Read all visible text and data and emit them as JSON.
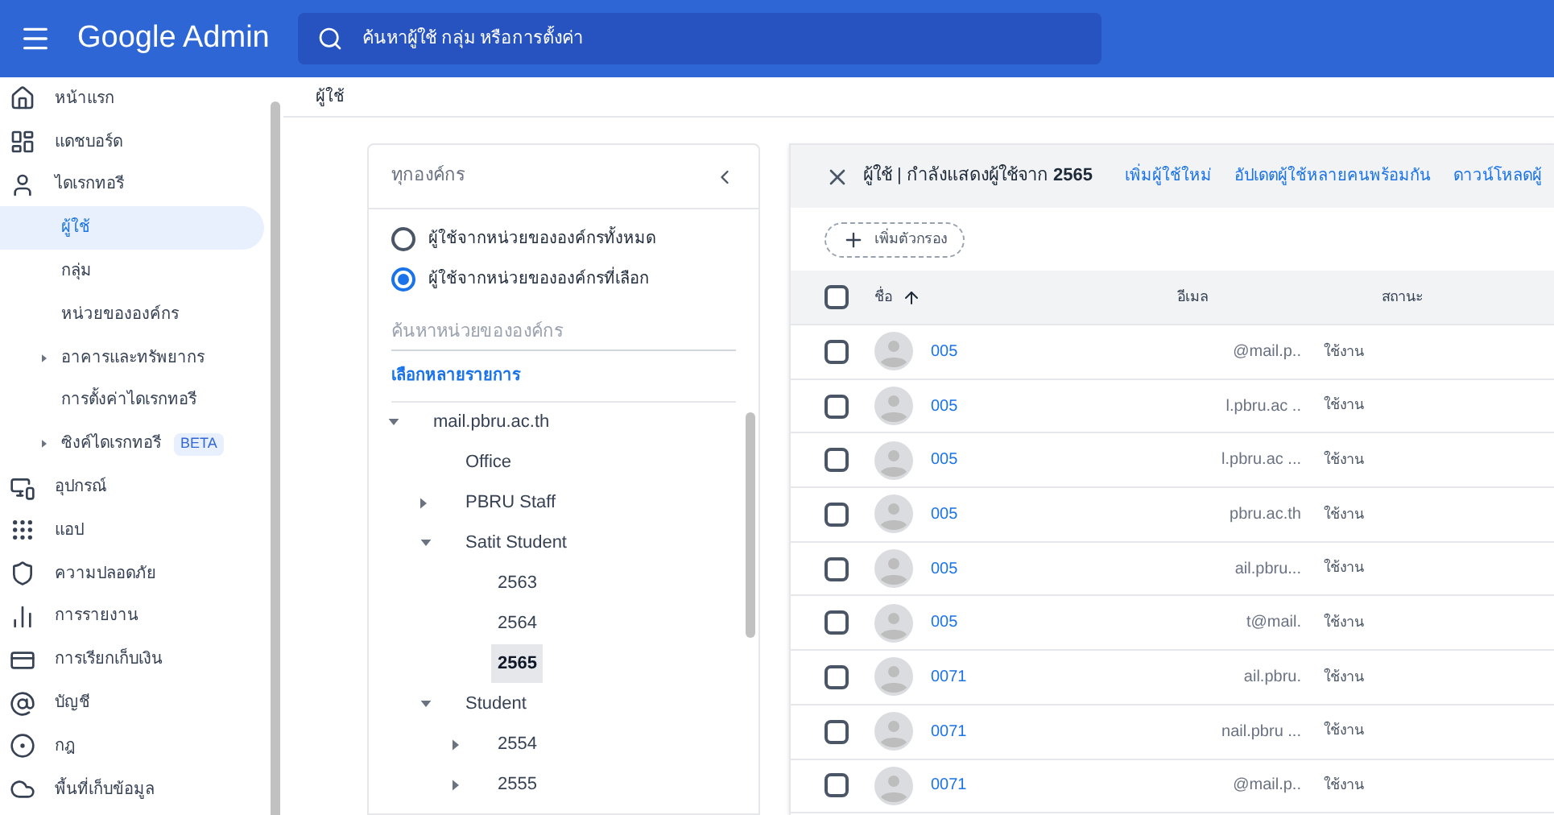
{
  "top_bar": {
    "title": "Google Admin",
    "search": {
      "placeholder": "ค้นหาผู้ใช้ กลุ่ม หรือการตั้งค่า"
    }
  },
  "sidebar": {
    "items": [
      {
        "label": "หน้าแรก",
        "selected": false
      },
      {
        "label": "แดชบอร์ด",
        "selected": false
      },
      {
        "label": "ไดเรกทอรี",
        "selected": false,
        "children": [
          {
            "label": "ผู้ใช้",
            "selected": true,
            "kind": "leaf"
          },
          {
            "label": "กลุ่ม",
            "selected": false,
            "kind": "leaf"
          },
          {
            "label": "หน่วยขององค์กร",
            "selected": false,
            "kind": "leaf"
          },
          {
            "label": "อาคารและทรัพยากร",
            "selected": false,
            "kind": "collapsed"
          },
          {
            "label": "การตั้งค่าไดเรกทอรี",
            "selected": false,
            "kind": "leaf"
          },
          {
            "label": "ซิงค์ไดเรกทอรี",
            "selected": false,
            "kind": "collapsed",
            "badge": "BETA"
          }
        ]
      },
      {
        "label": "อุปกรณ์",
        "selected": false
      },
      {
        "label": "แอป",
        "selected": false
      },
      {
        "label": "ความปลอดภัย",
        "selected": false
      },
      {
        "label": "การรายงาน",
        "selected": false
      },
      {
        "label": "การเรียกเก็บเงิน",
        "selected": false
      },
      {
        "label": "บัญชี",
        "selected": false
      },
      {
        "label": "กฎ",
        "selected": false
      },
      {
        "label": "พื้นที่เก็บข้อมูล",
        "selected": false
      }
    ]
  },
  "breadcrumb": "ผู้ใช้",
  "org_panel": {
    "title": "ทุกองค์กร",
    "options": [
      {
        "label": "ผู้ใช้จากหน่วยขององค์กรทั้งหมด",
        "selected": false
      },
      {
        "label": "ผู้ใช้จากหน่วยขององค์กรที่เลือก",
        "selected": true
      }
    ],
    "search": {
      "placeholder": "ค้นหาหน่วยขององค์กร"
    },
    "multi_select_link": "เลือกหลายรายการ",
    "tree": [
      {
        "label": "mail.pbru.ac.th",
        "kind": "expanded",
        "selected": false,
        "children": [
          {
            "label": "Office",
            "kind": "leaf",
            "selected": false
          },
          {
            "label": "PBRU Staff",
            "kind": "collapsed",
            "selected": false
          },
          {
            "label": "Satit Student",
            "kind": "expanded",
            "selected": false,
            "children": [
              {
                "label": "2563",
                "kind": "leaf",
                "selected": false
              },
              {
                "label": "2564",
                "kind": "leaf",
                "selected": false
              },
              {
                "label": "2565",
                "kind": "leaf",
                "selected": true
              }
            ]
          },
          {
            "label": "Student",
            "kind": "expanded",
            "selected": false,
            "children": [
              {
                "label": "2554",
                "kind": "collapsed",
                "selected": false
              },
              {
                "label": "2555",
                "kind": "collapsed",
                "selected": false
              }
            ]
          }
        ]
      }
    ]
  },
  "users_panel": {
    "title": "ผู้ใช้ | กำลังแสดงผู้ใช้จาก **2565**",
    "actions": [
      "เพิ่มผู้ใช้ใหม่",
      "อัปเดตผู้ใช้หลายคนพร้อมกัน",
      "ดาวน์โหลดผู้"
    ],
    "filter_button": "เพิ่มตัวกรอง",
    "columns": [
      {
        "label": "ชื่อ",
        "sorted": true
      },
      {
        "label": "อีเมล",
        "sorted": false
      },
      {
        "label": "สถานะ",
        "sorted": false
      }
    ],
    "header_checked": false,
    "rows": [
      {
        "name": "005",
        "email": "@mail.p..",
        "status": "ใช้งาน",
        "checked": false
      },
      {
        "name": "005",
        "email": "l.pbru.ac ..",
        "status": "ใช้งาน",
        "checked": false
      },
      {
        "name": "005",
        "email": "l.pbru.ac ...",
        "status": "ใช้งาน",
        "checked": false
      },
      {
        "name": "005",
        "email": "pbru.ac.th",
        "status": "ใช้งาน",
        "checked": false
      },
      {
        "name": "005",
        "email": "ail.pbru...",
        "status": "ใช้งาน",
        "checked": false
      },
      {
        "name": "005",
        "email": "t@mail.",
        "status": "ใช้งาน",
        "checked": false
      },
      {
        "name": "0071",
        "email": "ail.pbru.",
        "status": "ใช้งาน",
        "checked": false
      },
      {
        "name": "0071",
        "email": "nail.pbru ...",
        "status": "ใช้งาน",
        "checked": false
      },
      {
        "name": "0071",
        "email": "@mail.p..",
        "status": "ใช้งาน",
        "checked": false
      }
    ]
  }
}
